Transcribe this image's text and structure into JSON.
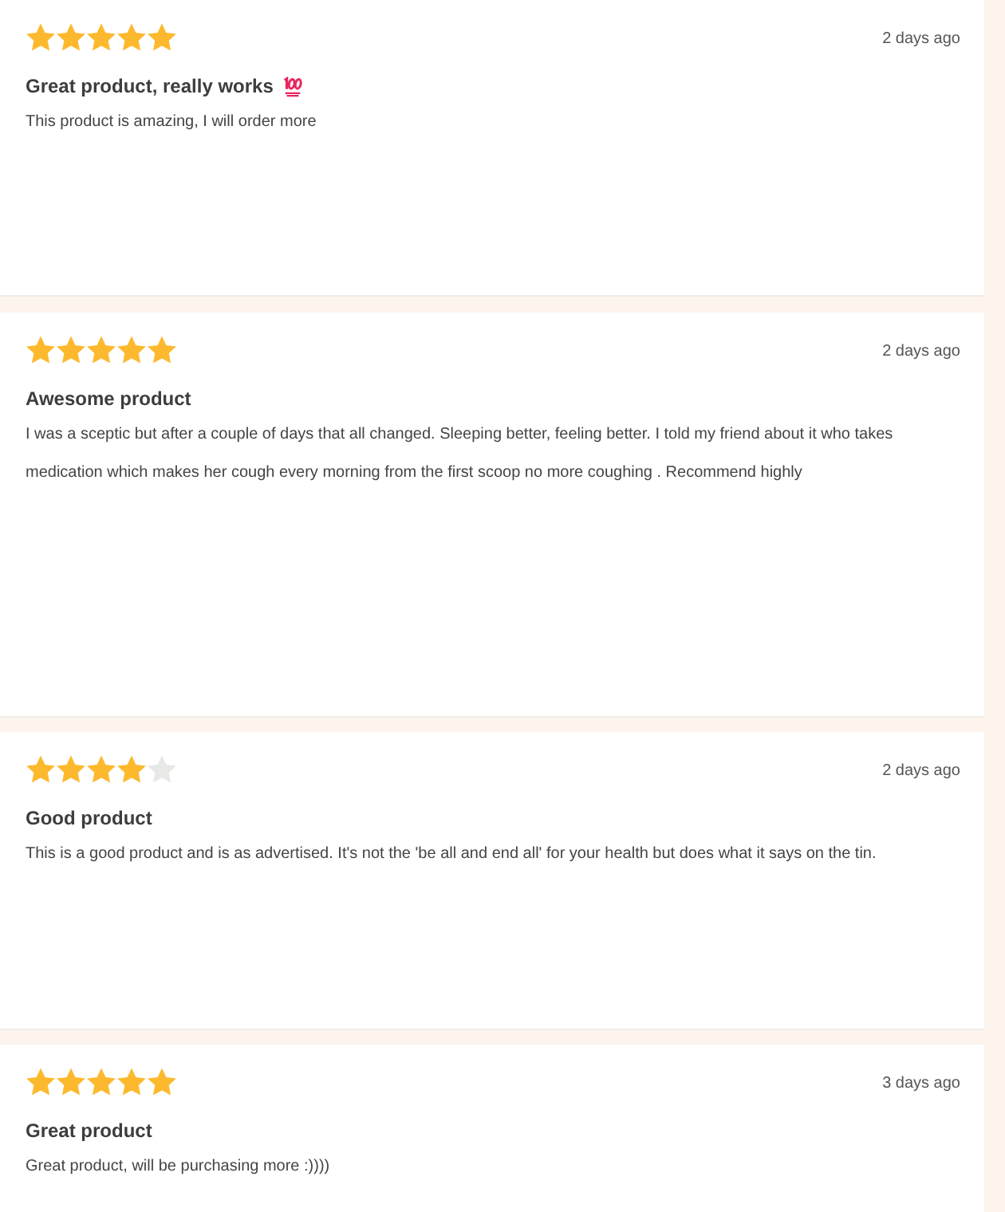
{
  "reviews": [
    {
      "stars": 5,
      "time": "2 days ago",
      "title": "Great product, really works",
      "emoji": true,
      "body": "This product is amazing, I will order more"
    },
    {
      "stars": 5,
      "time": "2 days ago",
      "title": "Awesome product",
      "emoji": false,
      "body": "I was a sceptic but after a couple of days that all changed. Sleeping better, feeling better. I told my friend about it who takes medication which makes her cough every morning from the first scoop no more coughing . Recommend highly"
    },
    {
      "stars": 4,
      "time": "2 days ago",
      "title": "Good product",
      "emoji": false,
      "body": "This is a good product and is as advertised. It's not the 'be all and end all' for your health but does what it says on the tin."
    },
    {
      "stars": 5,
      "time": "3 days ago",
      "title": "Great product",
      "emoji": false,
      "body": "Great product, will be purchasing more :))))"
    }
  ]
}
